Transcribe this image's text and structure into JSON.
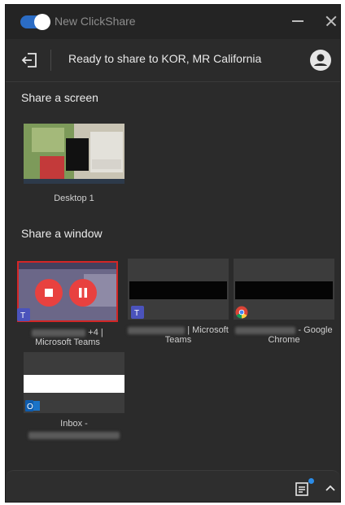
{
  "window": {
    "title": "New ClickShare",
    "toggle_on": true,
    "accent": "#2b6cc4"
  },
  "status": {
    "text": "Ready to share to KOR, MR California"
  },
  "share_screen": {
    "title": "Share a screen",
    "items": [
      {
        "label": "Desktop 1"
      }
    ]
  },
  "share_window": {
    "title": "Share a window",
    "items": [
      {
        "label_line1": "+4 |",
        "label_line2": "Microsoft Teams",
        "app_icon": "teams-icon",
        "selected": true
      },
      {
        "label_line1": "| Microsoft",
        "label_line2": "Teams",
        "app_icon": "teams-icon",
        "selected": false
      },
      {
        "label_line1": "- Google",
        "label_line2": "Chrome",
        "app_icon": "chrome-icon",
        "selected": false
      },
      {
        "label_line1": "Inbox -",
        "label_line2": "",
        "app_icon": "outlook-icon",
        "selected": false
      }
    ]
  },
  "controls": {
    "stop_color": "#e8413f",
    "pause_color": "#e8413f"
  },
  "bottom": {
    "calendar_icon": "calendar-icon",
    "badge_color": "#2b8ce8",
    "chevron_icon": "chevron-up-icon"
  }
}
